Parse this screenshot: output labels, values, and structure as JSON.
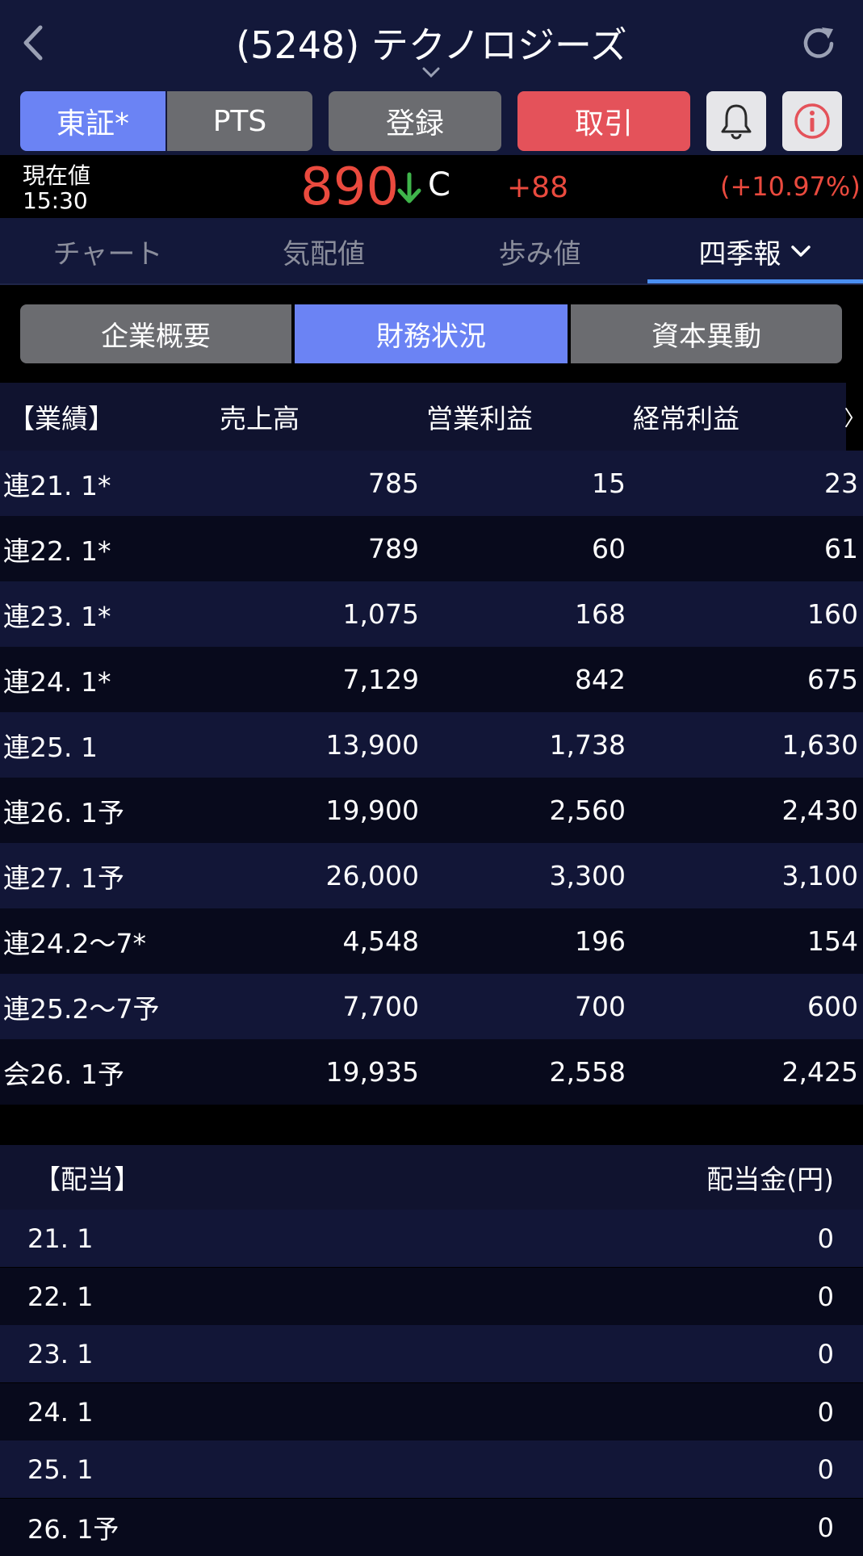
{
  "header": {
    "title": "(5248) テクノロジーズ"
  },
  "buttons": {
    "tse": "東証*",
    "pts": "PTS",
    "register": "登録",
    "trade": "取引"
  },
  "price": {
    "label": "現在値",
    "time": "15:30",
    "value": "890",
    "flag": "C",
    "change": "+88",
    "change_pct": "(+10.97%)"
  },
  "tabs": [
    "チャート",
    "気配値",
    "歩み値",
    "四季報"
  ],
  "segments": [
    "企業概要",
    "財務状況",
    "資本異動"
  ],
  "performance": {
    "header": [
      "【業績】",
      "売上高",
      "営業利益",
      "経常利益"
    ],
    "more": "〉",
    "rows": [
      [
        "連21. 1*",
        "785",
        "15",
        "23"
      ],
      [
        "連22. 1*",
        "789",
        "60",
        "61"
      ],
      [
        "連23. 1*",
        "1,075",
        "168",
        "160"
      ],
      [
        "連24. 1*",
        "7,129",
        "842",
        "675"
      ],
      [
        "連25. 1",
        "13,900",
        "1,738",
        "1,630"
      ],
      [
        "連26. 1予",
        "19,900",
        "2,560",
        "2,430"
      ],
      [
        "連27. 1予",
        "26,000",
        "3,300",
        "3,100"
      ],
      [
        "連24.2〜7*",
        "4,548",
        "196",
        "154"
      ],
      [
        "連25.2〜7予",
        "7,700",
        "700",
        "600"
      ],
      [
        "会26. 1予",
        "19,935",
        "2,558",
        "2,425"
      ]
    ]
  },
  "dividend": {
    "header": [
      "【配当】",
      "配当金(円)"
    ],
    "rows": [
      [
        "21. 1",
        "0"
      ],
      [
        "22. 1",
        "0"
      ],
      [
        "23. 1",
        "0"
      ],
      [
        "24. 1",
        "0"
      ],
      [
        "25. 1",
        "0"
      ],
      [
        "26. 1予",
        "0"
      ]
    ]
  },
  "colors": {
    "accent_blue": "#6b83f4",
    "trade_red": "#e4525a",
    "price_red": "#ea4a3e",
    "down_green": "#3fb54b"
  }
}
